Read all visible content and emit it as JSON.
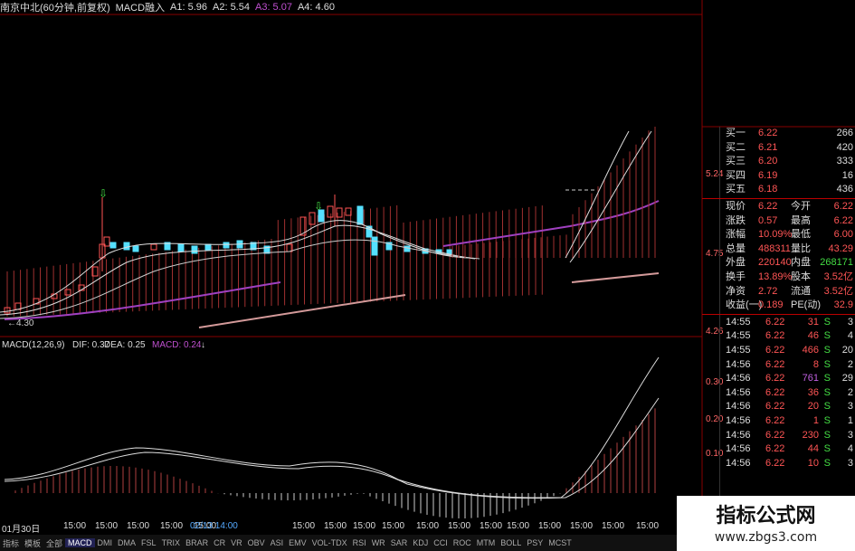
{
  "window": {
    "title": "南京中北(60分钟,前复权)"
  },
  "indicator_bar": {
    "name": "MACD融入",
    "a1": "A1: 5.96",
    "a2": "A2: 5.54",
    "a3": "A3: 5.07",
    "a4": "A4: 4.60"
  },
  "macd_bar": {
    "params": "MACD(12,26,9)",
    "dif": "DIF: 0.37",
    "dea": "DEA: 0.25",
    "macd": "MACD: 0.24"
  },
  "price_labels": {
    "p524": "5.24",
    "p475": "4.75",
    "p426": "4.26",
    "low_mark": "←4.30"
  },
  "macd_labels": {
    "m030": "0.30",
    "m020": "0.20",
    "m010": "0.10"
  },
  "order_book": [
    {
      "label": "买一",
      "price": "6.22",
      "vol": "266"
    },
    {
      "label": "买二",
      "price": "6.21",
      "vol": "420"
    },
    {
      "label": "买三",
      "price": "6.20",
      "vol": "333"
    },
    {
      "label": "买四",
      "price": "6.19",
      "vol": "16"
    },
    {
      "label": "买五",
      "price": "6.18",
      "vol": "436"
    }
  ],
  "stats": [
    {
      "l1": "现价",
      "v1": "6.22",
      "l2": "今开",
      "v2": "6.22"
    },
    {
      "l1": "涨跌",
      "v1": "0.57",
      "l2": "最高",
      "v2": "6.22"
    },
    {
      "l1": "涨幅",
      "v1": "10.09%",
      "l2": "最低",
      "v2": "6.00"
    },
    {
      "l1": "总量",
      "v1": "488311",
      "l2": "量比",
      "v2": "43.29"
    },
    {
      "l1": "外盘",
      "v1": "220140",
      "l2": "内盘",
      "v2": "268171"
    },
    {
      "l1": "换手",
      "v1": "13.89%",
      "l2": "股本",
      "v2": "3.52亿"
    },
    {
      "l1": "净资",
      "v1": "2.72",
      "l2": "流通",
      "v2": "3.52亿"
    },
    {
      "l1": "收益(一)",
      "v1": "0.189",
      "l2": "PE(动)",
      "v2": "32.9"
    }
  ],
  "ticks": [
    {
      "time": "14:55",
      "price": "6.22",
      "vol": "31",
      "side": "S",
      "n": "3"
    },
    {
      "time": "14:55",
      "price": "6.22",
      "vol": "46",
      "side": "S",
      "n": "4"
    },
    {
      "time": "14:55",
      "price": "6.22",
      "vol": "466",
      "side": "S",
      "n": "20"
    },
    {
      "time": "14:56",
      "price": "6.22",
      "vol": "8",
      "side": "S",
      "n": "2"
    },
    {
      "time": "14:56",
      "price": "6.22",
      "vol": "761",
      "side": "S",
      "n": "29"
    },
    {
      "time": "14:56",
      "price": "6.22",
      "vol": "36",
      "side": "S",
      "n": "2"
    },
    {
      "time": "14:56",
      "price": "6.22",
      "vol": "20",
      "side": "S",
      "n": "3"
    },
    {
      "time": "14:56",
      "price": "6.22",
      "vol": "1",
      "side": "S",
      "n": "1"
    },
    {
      "time": "14:56",
      "price": "6.22",
      "vol": "230",
      "side": "S",
      "n": "3"
    },
    {
      "time": "14:56",
      "price": "6.22",
      "vol": "44",
      "side": "S",
      "n": "4"
    },
    {
      "time": "14:56",
      "price": "6.22",
      "vol": "10",
      "side": "S",
      "n": "3"
    }
  ],
  "time_axis": [
    "01月30日",
    "15:00",
    "15:00",
    "15:00",
    "15:00",
    "15:00",
    "02/13 14:00",
    "15:00",
    "15:00",
    "15:00",
    "15:00",
    "15:00",
    "15:00",
    "15:00",
    "15:00",
    "15:00",
    "15:00",
    "15:00",
    "15:00"
  ],
  "bottom_tabs": [
    "指标",
    "模板",
    "全部",
    "MACD",
    "DMI",
    "DMA",
    "FSL",
    "TRIX",
    "BRAR",
    "CR",
    "VR",
    "OBV",
    "ASI",
    "EMV",
    "VOL-TDX",
    "RSI",
    "WR",
    "SAR",
    "KDJ",
    "CCI",
    "ROC",
    "MTM",
    "BOLL",
    "PSY",
    "MCST"
  ],
  "watermark": {
    "line1": "指标公式网",
    "line2": "www.zbgs3.com"
  },
  "colors": {
    "up": "#ff5555",
    "down": "#55e0ff",
    "ma_purple": "#a040c0",
    "axis_red": "#b00000",
    "green": "#44dd44"
  }
}
